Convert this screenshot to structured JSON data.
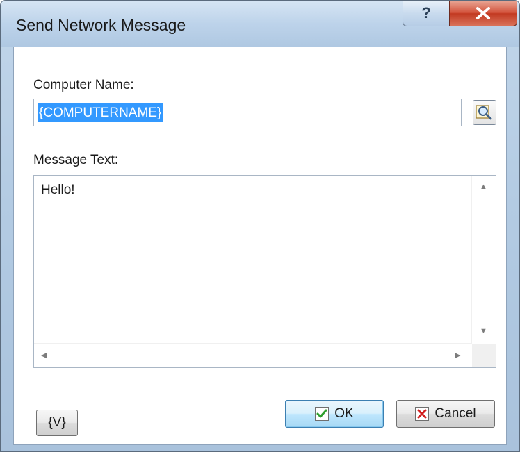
{
  "window": {
    "title": "Send Network Message"
  },
  "title_buttons": {
    "help": "?",
    "close_icon": "close-x"
  },
  "computer": {
    "label": "Computer Name:",
    "label_accel": "C",
    "label_rest": "omputer Name:",
    "value": "{COMPUTERNAME}",
    "browse_icon": "magnifier-browse"
  },
  "message": {
    "label": "Message Text:",
    "label_accel": "M",
    "label_rest": "essage Text:",
    "value": "Hello!"
  },
  "footer": {
    "variables_label": "{V}",
    "ok_label": "OK",
    "cancel_label": "Cancel"
  },
  "colors": {
    "selection": "#3399ff",
    "close_button": "#c23a22",
    "ok_check": "#2e9f2e",
    "cancel_x": "#d21e1e"
  }
}
